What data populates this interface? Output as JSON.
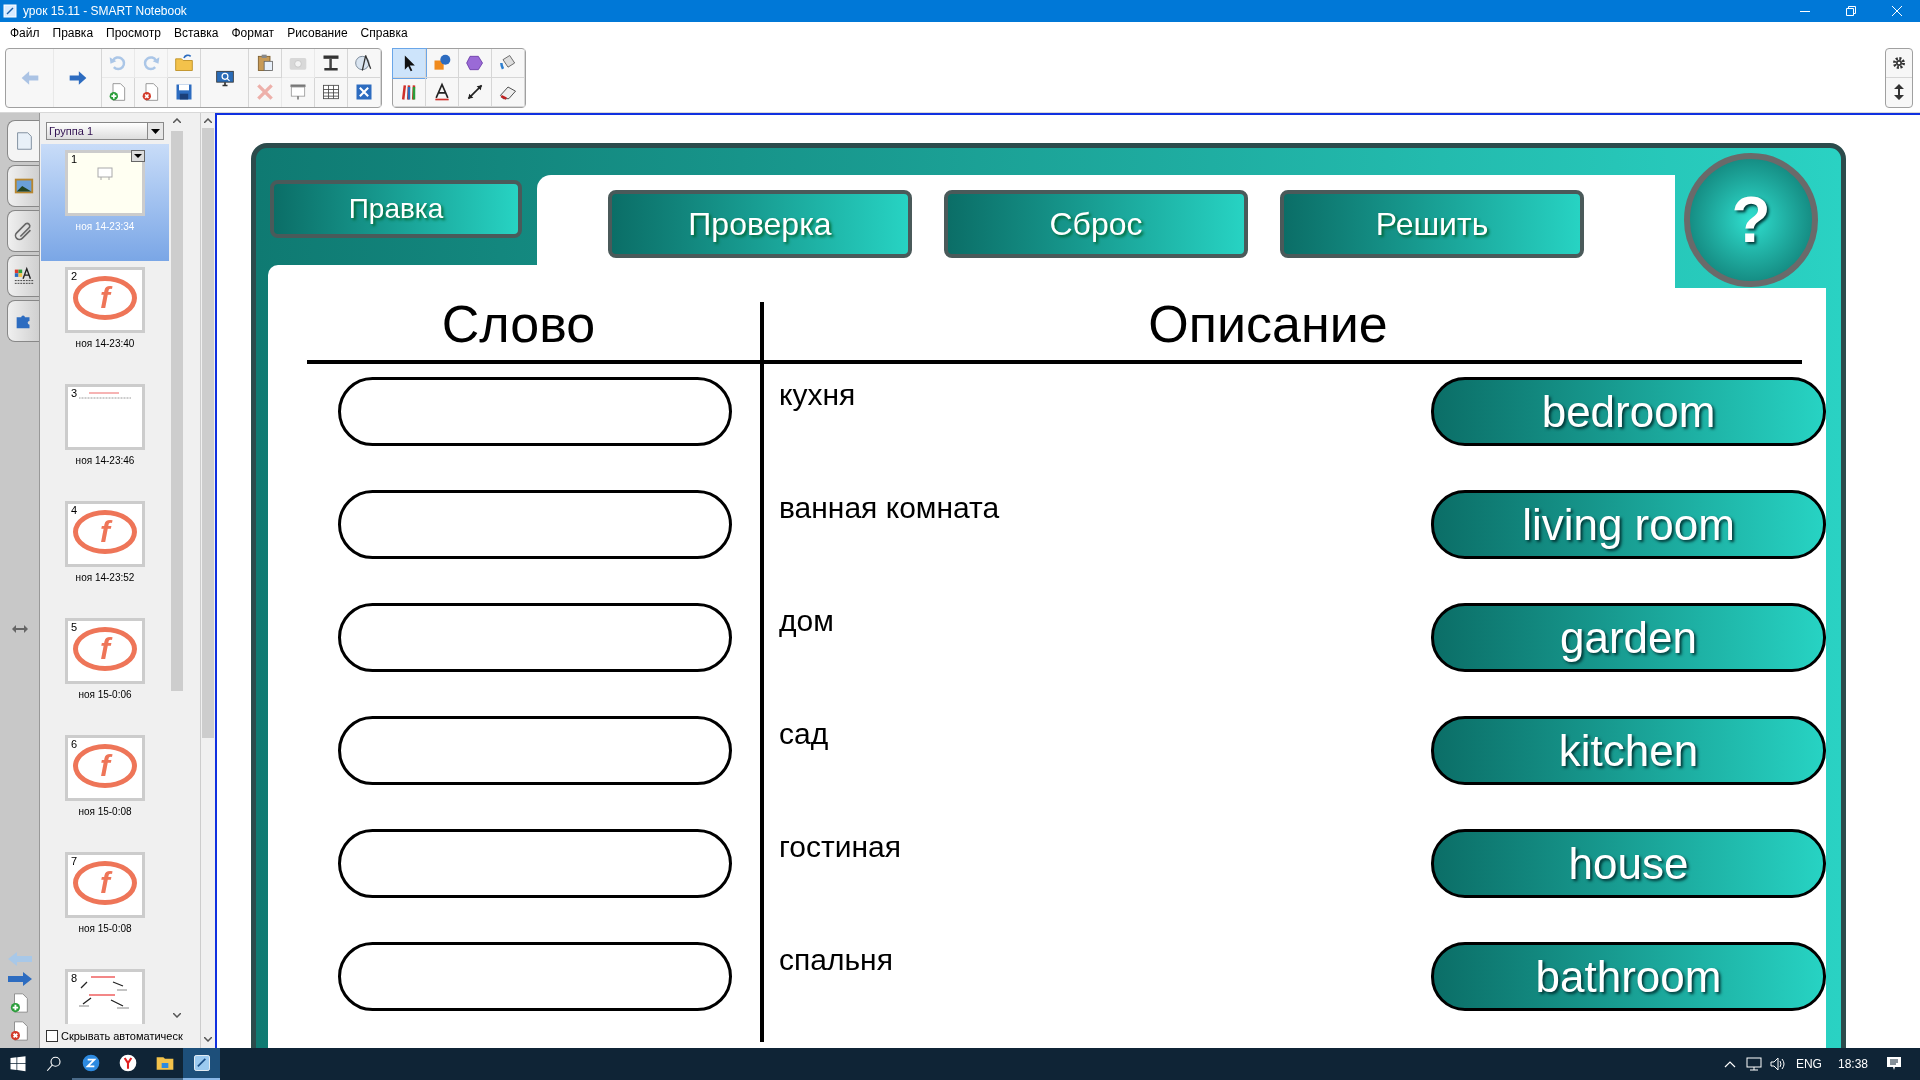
{
  "window": {
    "title": "урок 15.11 - SMART Notebook"
  },
  "menu": [
    "Файл",
    "Правка",
    "Просмотр",
    "Вставка",
    "Формат",
    "Рисование",
    "Справка"
  ],
  "toolbar": {
    "buttons": [
      {
        "disabled": true
      },
      {
        "disabled": false
      },
      {
        "disabled": true
      },
      {
        "disabled": false
      },
      {
        "disabled": true
      },
      {
        "disabled": false
      },
      {
        "disabled": false
      },
      {
        "disabled": false
      },
      {
        "disabled": false
      },
      {
        "disabled": false
      },
      {
        "disabled": true
      },
      {
        "disabled": true
      },
      {
        "disabled": false
      },
      {
        "disabled": false
      },
      {
        "disabled": false
      },
      {
        "disabled": false
      },
      {
        "disabled": false
      }
    ],
    "tools": [
      {
        "selected": true
      },
      {
        "selected": false
      },
      {
        "selected": false
      },
      {
        "selected": false
      },
      {
        "selected": false
      },
      {
        "selected": false
      },
      {
        "selected": false
      },
      {
        "selected": false
      }
    ]
  },
  "side_tabs": [
    {
      "selected": true
    },
    {
      "selected": false
    },
    {
      "selected": false
    },
    {
      "selected": false
    },
    {
      "selected": false
    }
  ],
  "sidebar": {
    "group": "Группа 1",
    "pages": [
      {
        "number": "1",
        "time": "ноя 14-23:34",
        "selected": true,
        "kind": "blank"
      },
      {
        "number": "2",
        "time": "ноя 14-23:40",
        "selected": false,
        "kind": "logo",
        "logo_text": "f"
      },
      {
        "number": "3",
        "time": "ноя 14-23:46",
        "selected": false,
        "kind": "text"
      },
      {
        "number": "4",
        "time": "ноя 14-23:52",
        "selected": false,
        "kind": "logo",
        "logo_text": "f"
      },
      {
        "number": "5",
        "time": "ноя 15-0:06",
        "selected": false,
        "kind": "logo",
        "logo_text": "f"
      },
      {
        "number": "6",
        "time": "ноя 15-0:08",
        "selected": false,
        "kind": "logo",
        "logo_text": "f"
      },
      {
        "number": "7",
        "time": "ноя 15-0:08",
        "selected": false,
        "kind": "logo",
        "logo_text": "f"
      },
      {
        "number": "8",
        "selected": false,
        "kind": "diagram"
      }
    ],
    "autohide": {
      "label": "Скрывать автоматическ",
      "checked": false
    }
  },
  "slide": {
    "edit_button": "Правка",
    "buttons": [
      "Проверка",
      "Сброс",
      "Решить"
    ],
    "help": "?",
    "headers": [
      "Слово",
      "Описание"
    ],
    "rows": [
      {
        "description": "кухня",
        "word": "bedroom"
      },
      {
        "description": "ванная комната",
        "word": "living room"
      },
      {
        "description": "дом",
        "word": "garden"
      },
      {
        "description": "сад",
        "word": "kitchen"
      },
      {
        "description": "гостиная",
        "word": "house"
      },
      {
        "description": "спальня",
        "word": "bathroom"
      }
    ]
  },
  "taskbar": {
    "apps": [
      {
        "active": false
      },
      {
        "active": false
      },
      {
        "active": false
      },
      {
        "active": true
      }
    ],
    "language": "ENG",
    "time": "18:38"
  }
}
